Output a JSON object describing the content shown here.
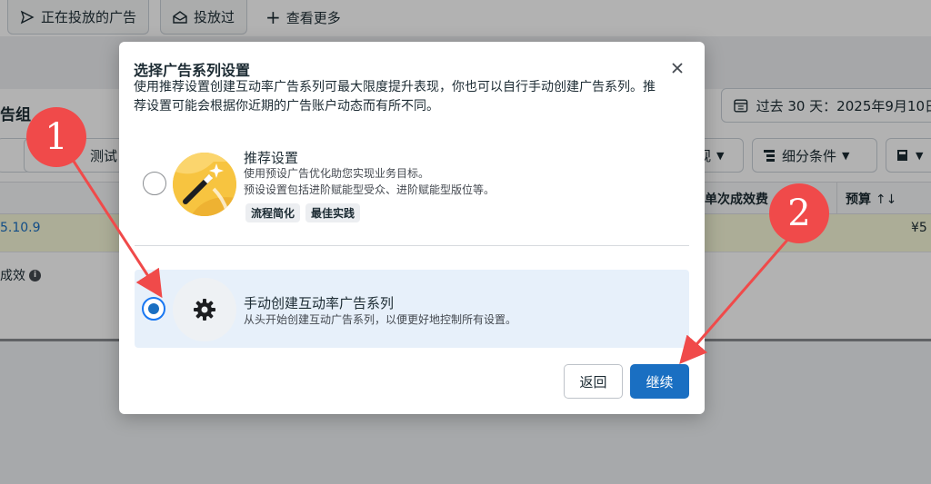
{
  "background": {
    "tabs": [
      {
        "label": "正在投放的广告"
      },
      {
        "label": "投放过"
      },
      {
        "label": "查看更多"
      }
    ],
    "group_title": "告组",
    "date_range": "过去 30 天：2025年9月10日",
    "toolbar": {
      "test_label": "测试",
      "view_label": "观",
      "breakdown_label": "细分条件"
    },
    "table": {
      "headers": [
        "单次成效费",
        "预算"
      ],
      "row_link": "5.10.9",
      "row_price": "¥5",
      "row_effect_label": "成效"
    }
  },
  "dialog": {
    "title": "选择广告系列设置",
    "description": "使用推荐设置创建互动率广告系列可最大限度提升表现，你也可以自行手动创建广告系列。推荐设置可能会根据你近期的广告账户动态而有所不同。",
    "options": [
      {
        "title": "推荐设置",
        "subtitle_lines": [
          "使用预设广告优化助您实现业务目标。",
          "预设设置包括进阶赋能型受众、进阶赋能型版位等。"
        ],
        "tags": [
          "流程简化",
          "最佳实践"
        ],
        "selected": false
      },
      {
        "title": "手动创建互动率广告系列",
        "subtitle_lines": [
          "从头开始创建互动广告系列，以便更好地控制所有设置。"
        ],
        "selected": true
      }
    ],
    "back_label": "返回",
    "continue_label": "继续",
    "accent_color": "#1a6fc2"
  },
  "annotations": {
    "marker_1": "1",
    "marker_2": "2",
    "color": "#f04a4a"
  }
}
